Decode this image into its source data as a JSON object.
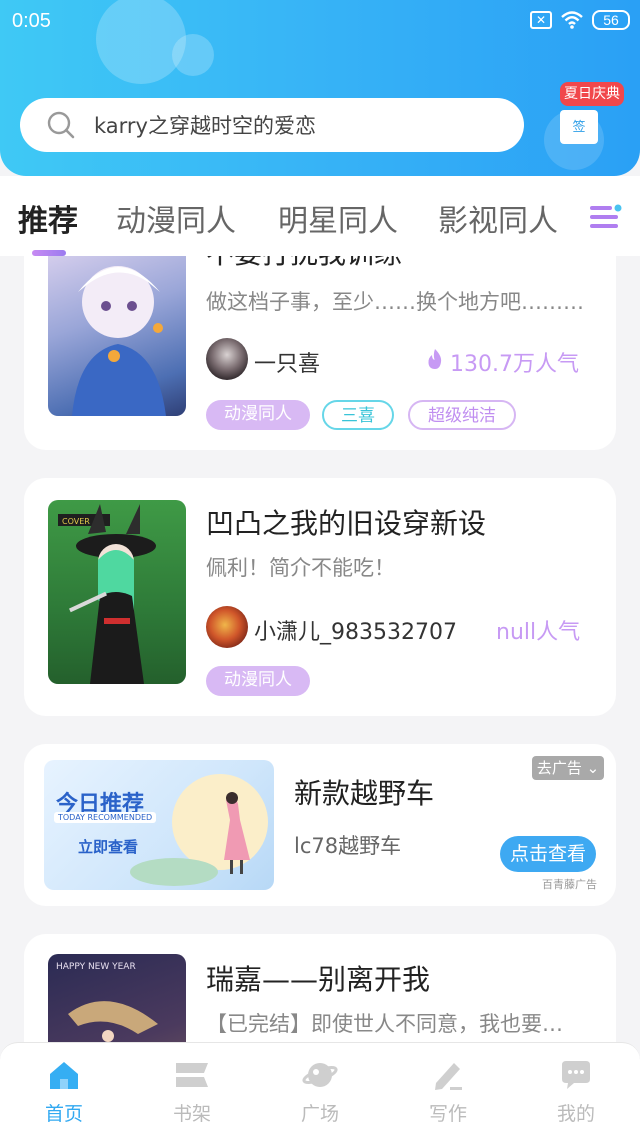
{
  "status_bar": {
    "time": "0:05",
    "battery": "56",
    "sim_icon": "sim-off-icon",
    "wifi_icon": "wifi-icon"
  },
  "search": {
    "value": "karry之穿越时空的爱恋",
    "icon": "search-icon"
  },
  "promo": {
    "badge": "夏日庆典",
    "sign_label": "签",
    "icon": "gift-icon"
  },
  "tabs": [
    {
      "label": "推荐",
      "active": true
    },
    {
      "label": "动漫同人",
      "active": false
    },
    {
      "label": "明星同人",
      "active": false
    },
    {
      "label": "影视同人",
      "active": false
    }
  ],
  "tabs_menu_icon": "menu-icon",
  "books": [
    {
      "title": "不要打扰我训练",
      "desc": "做这档子事，至少……换个地方吧………",
      "author": "一只喜",
      "popularity": "130.7万人气",
      "popularity_icon": "flame-icon",
      "tags": [
        "动漫同人",
        "三喜",
        "超级纯洁"
      ]
    },
    {
      "title": "凹凸之我的旧设穿新设",
      "desc": "佩利！简介不能吃！",
      "author": "小潇儿_983532707",
      "popularity": "null人气",
      "tags": [
        "动漫同人"
      ]
    },
    {
      "title": "瑞嘉——别离开我",
      "desc": "【已完结】即使世人不同意，我也要…",
      "cover_text": "HAPPY NEW YEAR"
    }
  ],
  "ad": {
    "banner_title": "今日推荐",
    "banner_subtitle": "TODAY RECOMMENDED",
    "banner_cta": "立即查看",
    "title": "新款越野车",
    "subtitle": "lc78越野车",
    "button": "点击查看",
    "remove": "去广告",
    "source": "百青藤广告"
  },
  "bottom_nav": [
    {
      "label": "首页",
      "icon": "home-icon",
      "active": true
    },
    {
      "label": "书架",
      "icon": "bookshelf-icon",
      "active": false
    },
    {
      "label": "广场",
      "icon": "planet-icon",
      "active": false
    },
    {
      "label": "写作",
      "icon": "pen-icon",
      "active": false
    },
    {
      "label": "我的",
      "icon": "chat-icon",
      "active": false
    }
  ],
  "colors": {
    "header_start": "#3fc9f5",
    "header_end": "#2aa0f5",
    "accent": "#32a9f1",
    "popularity": "#c79af4"
  }
}
